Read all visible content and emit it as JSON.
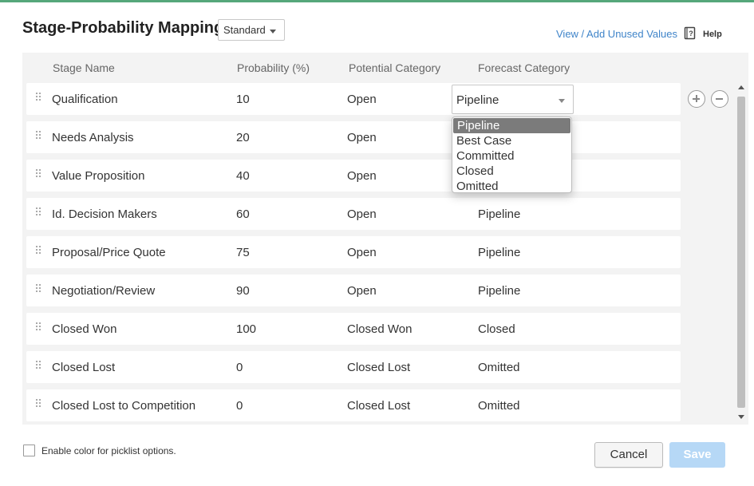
{
  "colors": {
    "accent_bar": "#56a77b",
    "link": "#3f84c9",
    "save_disabled": "#b6d8f6",
    "selected_option": "#7b7b7b"
  },
  "header": {
    "title": "Stage-Probability Mapping",
    "layout_select": {
      "value": "Standard",
      "icon": "caret-down-icon"
    },
    "view_link": "View / Add Unused Values",
    "help": {
      "label": "Help",
      "icon": "help-book-icon"
    }
  },
  "table": {
    "columns": [
      "Stage Name",
      "Probability (%)",
      "Potential Category",
      "Forecast Category"
    ],
    "rows": [
      {
        "stage": "Qualification",
        "probability": "10",
        "potential": "Open",
        "forecast": "Pipeline"
      },
      {
        "stage": "Needs Analysis",
        "probability": "20",
        "potential": "Open",
        "forecast": ""
      },
      {
        "stage": "Value Proposition",
        "probability": "40",
        "potential": "Open",
        "forecast": ""
      },
      {
        "stage": "Id. Decision Makers",
        "probability": "60",
        "potential": "Open",
        "forecast": "Pipeline"
      },
      {
        "stage": "Proposal/Price Quote",
        "probability": "75",
        "potential": "Open",
        "forecast": "Pipeline"
      },
      {
        "stage": "Negotiation/Review",
        "probability": "90",
        "potential": "Open",
        "forecast": "Pipeline"
      },
      {
        "stage": "Closed Won",
        "probability": "100",
        "potential": "Closed Won",
        "forecast": "Closed"
      },
      {
        "stage": "Closed Lost",
        "probability": "0",
        "potential": "Closed Lost",
        "forecast": "Omitted"
      },
      {
        "stage": "Closed Lost to Competition",
        "probability": "0",
        "potential": "Closed Lost",
        "forecast": "Omitted"
      }
    ],
    "active_select": {
      "value": "Pipeline"
    },
    "dropdown_options": [
      "Pipeline",
      "Best Case",
      "Committed",
      "Closed",
      "Omitted"
    ],
    "selected_option": "Pipeline"
  },
  "footer": {
    "checkbox_label": "Enable color for picklist options.",
    "checkbox_checked": false,
    "cancel_label": "Cancel",
    "save_label": "Save"
  }
}
